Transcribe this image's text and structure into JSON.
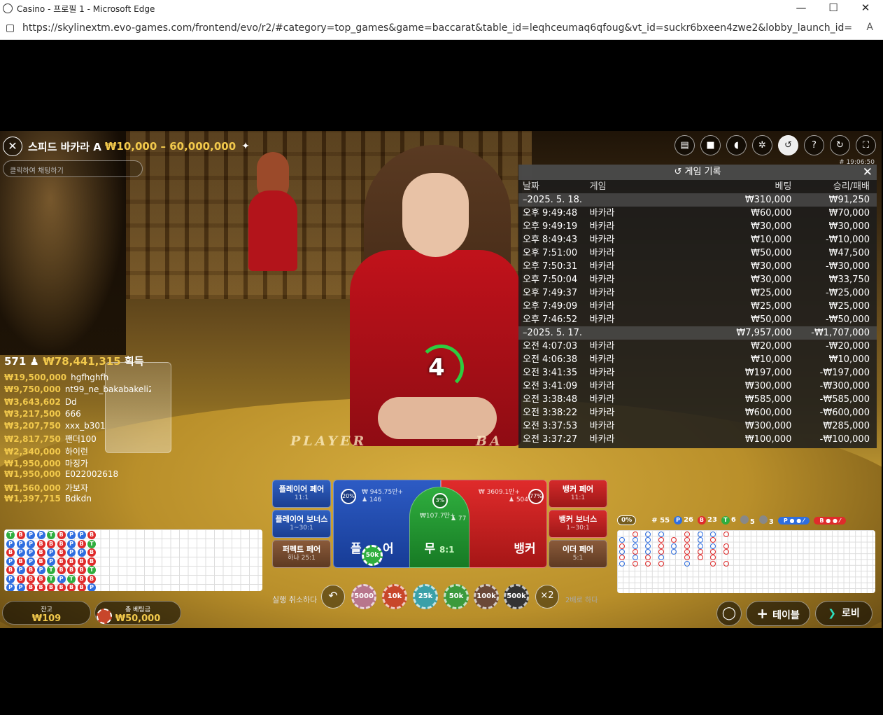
{
  "window": {
    "title": "Casino - 프로필 1 - Microsoft Edge",
    "url": "https://skylinextm.evo-games.com/frontend/evo/r2/#category=top_games&game=baccarat&table_id=leqhceumaq6qfoug&vt_id=suckr6bxeen4zwe2&lobby_launch_id=faea2c6f3ce147b8a9b...",
    "minimize": "—",
    "maximize": "☐",
    "close": "✕"
  },
  "game": {
    "title": "스피드 바카라 A",
    "limits": "₩10,000 – 60,000,000",
    "chat_placeholder": "클릭하여 채팅하기",
    "time": "# 19:06:50",
    "countdown": "4",
    "table_text_player": "PLAYER",
    "table_text_banker": "BA"
  },
  "history": {
    "title": "게임 기록",
    "columns": [
      "날짜",
      "게임",
      "베팅",
      "승리/패배"
    ],
    "rows": [
      {
        "date": "–2025. 5. 18.",
        "game": "",
        "bet": "₩310,000",
        "result": "₩91,250",
        "is_date": true
      },
      {
        "date": "오후 9:49:48",
        "game": "바카라",
        "bet": "₩60,000",
        "result": "₩70,000"
      },
      {
        "date": "오후 9:49:19",
        "game": "바카라",
        "bet": "₩30,000",
        "result": "₩30,000"
      },
      {
        "date": "오후 8:49:43",
        "game": "바카라",
        "bet": "₩10,000",
        "result": "-₩10,000"
      },
      {
        "date": "오후 7:51:00",
        "game": "바카라",
        "bet": "₩50,000",
        "result": "₩47,500"
      },
      {
        "date": "오후 7:50:31",
        "game": "바카라",
        "bet": "₩30,000",
        "result": "-₩30,000"
      },
      {
        "date": "오후 7:50:04",
        "game": "바카라",
        "bet": "₩30,000",
        "result": "₩33,750"
      },
      {
        "date": "오후 7:49:37",
        "game": "바카라",
        "bet": "₩25,000",
        "result": "-₩25,000"
      },
      {
        "date": "오후 7:49:09",
        "game": "바카라",
        "bet": "₩25,000",
        "result": "₩25,000"
      },
      {
        "date": "오후 7:46:52",
        "game": "바카라",
        "bet": "₩50,000",
        "result": "-₩50,000"
      },
      {
        "date": "–2025. 5. 17.",
        "game": "",
        "bet": "₩7,957,000",
        "result": "-₩1,707,000",
        "is_date": true
      },
      {
        "date": "오전 4:07:03",
        "game": "바카라",
        "bet": "₩20,000",
        "result": "-₩20,000"
      },
      {
        "date": "오전 4:06:38",
        "game": "바카라",
        "bet": "₩10,000",
        "result": "₩10,000"
      },
      {
        "date": "오전 3:41:35",
        "game": "바카라",
        "bet": "₩197,000",
        "result": "-₩197,000"
      },
      {
        "date": "오전 3:41:09",
        "game": "바카라",
        "bet": "₩300,000",
        "result": "-₩300,000"
      },
      {
        "date": "오전 3:38:48",
        "game": "바카라",
        "bet": "₩585,000",
        "result": "-₩585,000"
      },
      {
        "date": "오전 3:38:22",
        "game": "바카라",
        "bet": "₩600,000",
        "result": "-₩600,000"
      },
      {
        "date": "오전 3:37:53",
        "game": "바카라",
        "bet": "₩300,000",
        "result": "₩285,000"
      },
      {
        "date": "오전 3:37:27",
        "game": "바카라",
        "bet": "₩100,000",
        "result": "-₩100,000"
      }
    ]
  },
  "winners": {
    "count": "571",
    "total": "₩78,441,315",
    "suffix": "획득",
    "list": [
      {
        "amount": "₩19,500,000",
        "name": "hgfhghfh"
      },
      {
        "amount": "₩9,750,000",
        "name": "nt99_ne_bakabakeli2"
      },
      {
        "amount": "₩3,643,602",
        "name": "Dd"
      },
      {
        "amount": "₩3,217,500",
        "name": "666"
      },
      {
        "amount": "₩3,207,750",
        "name": "xxx_b301"
      },
      {
        "amount": "₩2,817,750",
        "name": "팬더100"
      },
      {
        "amount": "₩2,340,000",
        "name": "하이런"
      },
      {
        "amount": "₩1,950,000",
        "name": "마징가"
      },
      {
        "amount": "₩1,950,000",
        "name": "E022002618"
      },
      {
        "amount": "₩1,560,000",
        "name": "가보자"
      },
      {
        "amount": "₩1,397,715",
        "name": "Bdkdn"
      }
    ]
  },
  "bets": {
    "player_pair": {
      "label": "플레이어 페어",
      "odds": "11:1"
    },
    "player_bonus": {
      "label": "플레이어 보너스",
      "odds": "1~30:1"
    },
    "perfect_pair": {
      "label": "퍼펙트 페어",
      "odds": "하나 25:1"
    },
    "banker_pair": {
      "label": "뱅커 페어",
      "odds": "11:1"
    },
    "banker_bonus": {
      "label": "뱅커 보너스",
      "odds": "1~30:1"
    },
    "either_pair": {
      "label": "이더 페어",
      "odds": "5:1"
    },
    "player": {
      "label": "플",
      "label2": "어",
      "amount": "₩ 945.75만+",
      "players": "♟ 146",
      "pct": "20%"
    },
    "tie": {
      "label": "무",
      "odds": "8:1",
      "amount": "₩107.7만+",
      "players": "♟ 77",
      "pct": "3%"
    },
    "banker": {
      "label": "뱅커",
      "amount": "₩ 3609.1만+",
      "players": "♟ 504",
      "pct": "77%"
    },
    "placed_chip": "50k"
  },
  "controls": {
    "undo_label": "실행 취소하다",
    "undo_icon": "↶",
    "chips": [
      "5000",
      "10k",
      "25k",
      "50k",
      "100k",
      "500k"
    ],
    "double_icon": "×2",
    "double_label": "2배로 하다"
  },
  "stats": {
    "pct": "0%",
    "rounds": "# 55",
    "p_count": "26",
    "b_count": "23",
    "t_count": "6",
    "pp_count": "5",
    "bp_count": "3",
    "p_letter": "P",
    "b_letter": "B",
    "t_letter": "T"
  },
  "beadroad": [
    [
      "T",
      "P",
      "B",
      "P",
      "B",
      "P",
      "P"
    ],
    [
      "B",
      "P",
      "P",
      "B",
      "P",
      "B",
      "P"
    ],
    [
      "P",
      "P",
      "P",
      "P",
      "B",
      "B",
      "B"
    ],
    [
      "P",
      "B",
      "B",
      "B",
      "P",
      "B",
      "B"
    ],
    [
      "T",
      "B",
      "P",
      "P",
      "T",
      "T",
      "B"
    ],
    [
      "B",
      "B",
      "B",
      "B",
      "B",
      "P",
      "B"
    ],
    [
      "P",
      "P",
      "P",
      "B",
      "B",
      "T",
      "B"
    ],
    [
      "P",
      "B",
      "P",
      "B",
      "B",
      "B",
      "B"
    ],
    [
      "B",
      "T",
      "B",
      "B",
      "T",
      "B",
      "P"
    ]
  ],
  "bottom": {
    "balance_label": "잔고",
    "balance": "₩109",
    "total_bet_label": "총 베팅금",
    "total_bet": "₩50,000",
    "table_button": "테이블",
    "lobby_button": "로비",
    "plus_icon": "+",
    "lobby_icon": "❯"
  },
  "colors": {
    "player": "#2f6ee0",
    "banker": "#e02b2b",
    "tie": "#2fae3e",
    "gold": "#f2c94c"
  }
}
